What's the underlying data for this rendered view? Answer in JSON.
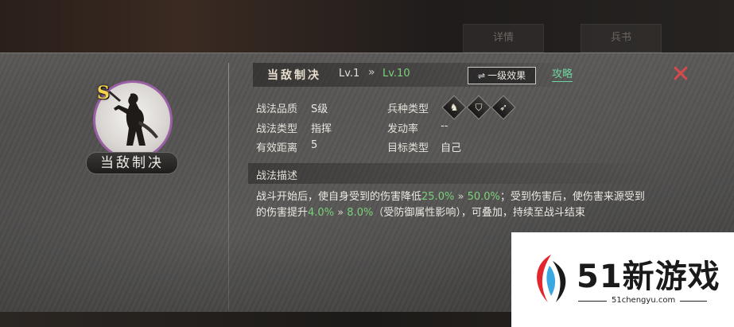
{
  "background": {
    "tabs": [
      "详情",
      "兵书"
    ]
  },
  "portrait": {
    "grade": "S",
    "name": "当敌制决"
  },
  "header": {
    "skill_name": "当敌制决",
    "level_current": "Lv.1",
    "level_arrow": "»",
    "level_max": "Lv.10",
    "effect_button": "一级效果",
    "effect_button_icon": "swap-icon",
    "strategy_link": "攻略",
    "close_icon": "close-icon"
  },
  "attributes": {
    "quality_label": "战法品质",
    "quality_value": "S级",
    "type_label": "战法类型",
    "type_value": "指挥",
    "range_label": "有效距离",
    "range_value": "5",
    "troop_label": "兵种类型",
    "troop_icons": [
      "cavalry-icon",
      "shield-icon",
      "bow-icon"
    ],
    "trigger_label": "发动率",
    "trigger_value": "--",
    "target_label": "目标类型",
    "target_value": "自己"
  },
  "description": {
    "title": "战法描述",
    "part1": "战斗开始后，使自身受到的伤害降低",
    "val1_from": "25.0%",
    "arrow": "»",
    "val1_to": "50.0%",
    "part2": "；受到伤害后，使伤害来源受到的伤害提升",
    "val2_from": "4.0%",
    "val2_to": "8.0%",
    "part3": "（受防御属性影响），可叠加，持续至战斗结束"
  },
  "watermark": {
    "brand": "51新游戏",
    "url": "51chengyu.com"
  },
  "colors": {
    "accent_green": "#7bd07a",
    "link_green": "#6fd4a0",
    "close_red": "#d9484a",
    "grade_gold": "#f5d24a",
    "portrait_ring": "#9a5fa5"
  }
}
